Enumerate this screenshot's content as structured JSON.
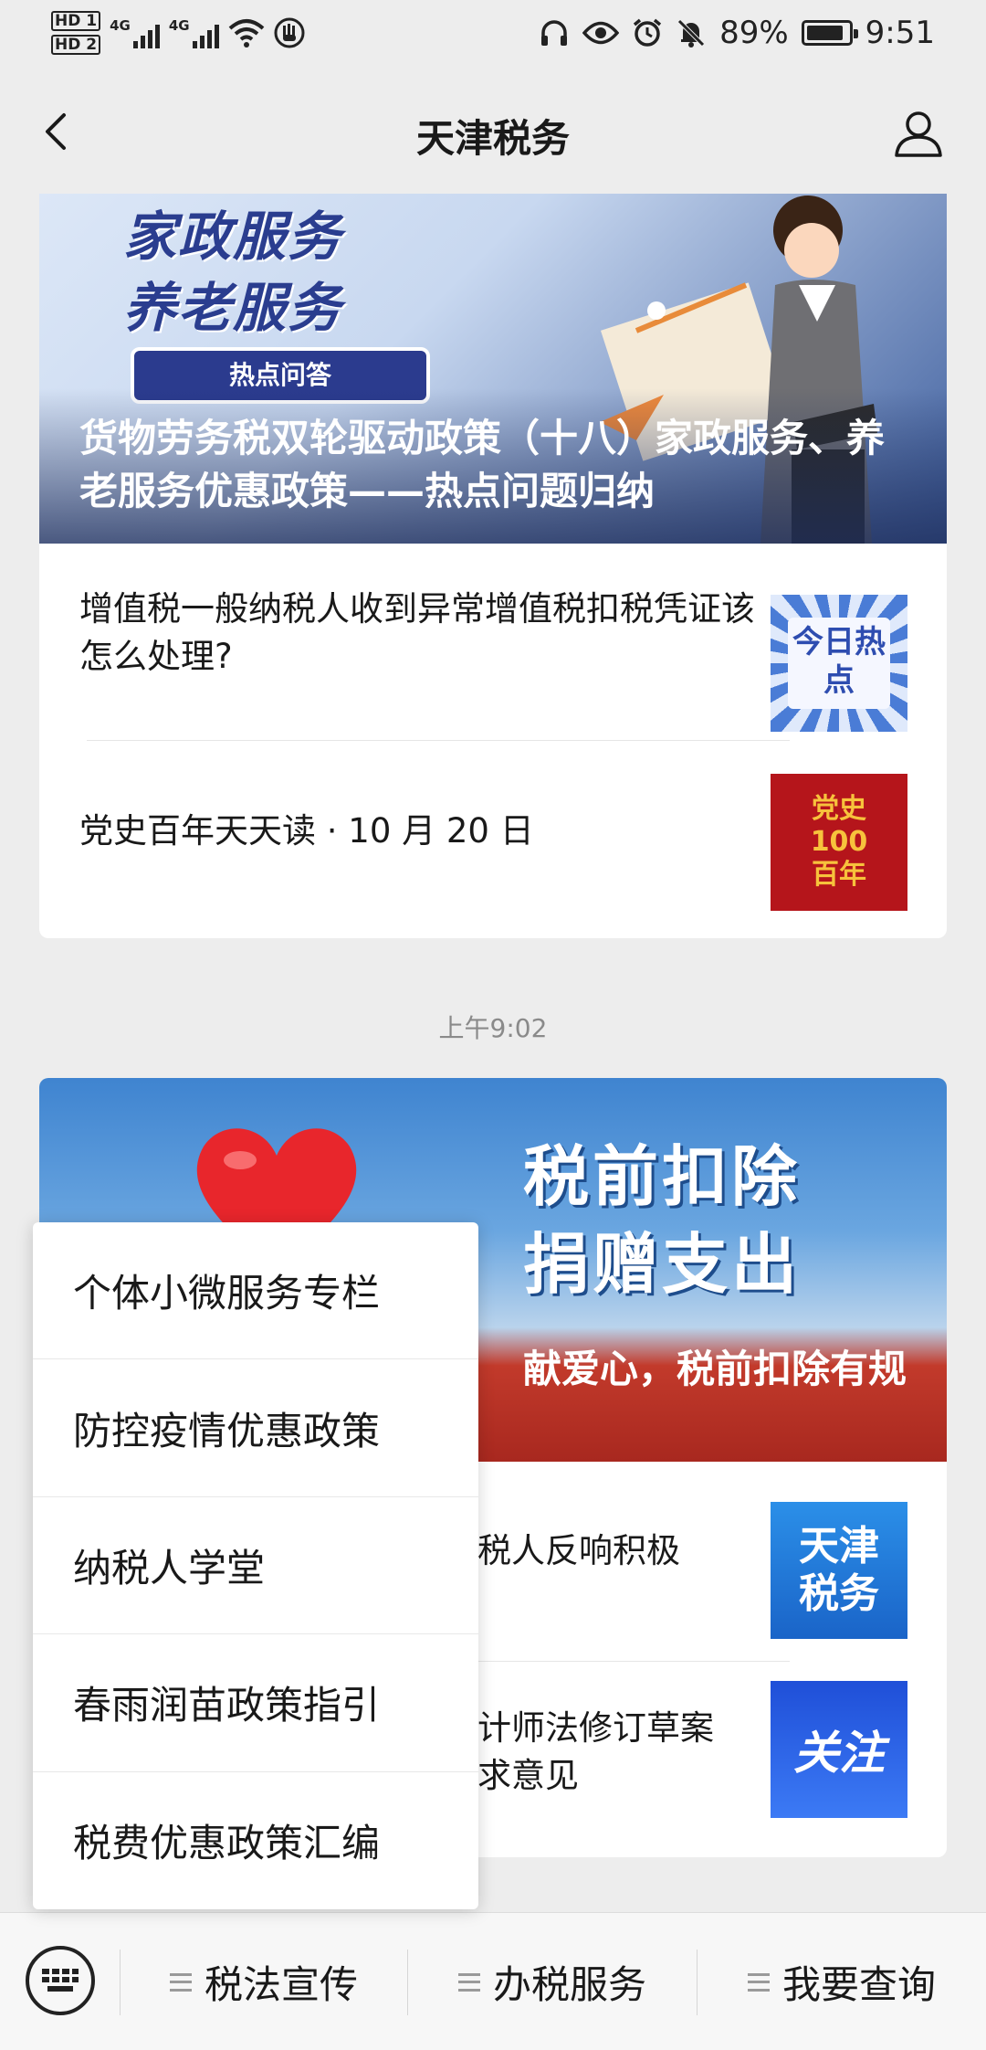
{
  "status_bar": {
    "hd1": "HD 1",
    "hd2": "HD 2",
    "net1": "4G",
    "net2": "4G",
    "battery": "89%",
    "time": "9:51"
  },
  "nav": {
    "title": "天津税务",
    "back_icon": "chevron-left-icon",
    "profile_icon": "user-icon"
  },
  "article_group_1": {
    "banner_big_line1": "家政服务",
    "banner_big_line2": "养老服务",
    "banner_tag": "热点问答",
    "banner_caption": "货物劳务税双轮驱动政策（十八）家政服务、养老服务优惠政策——热点问题归纳",
    "items": [
      {
        "title": "增值税一般纳税人收到异常增值税扣税凭证该怎么处理?",
        "thumb_text": "今日热点"
      },
      {
        "title": "党史百年天天读 · 10 月 20 日",
        "thumb_line1": "党史",
        "thumb_line2": "100",
        "thumb_line3": "百年"
      }
    ]
  },
  "timestamp": "上午9:02",
  "article_group_2": {
    "banner_big_line1": "税前扣除",
    "banner_big_line2": "捐赠支出",
    "banner_caption": "献爱心，税前扣除有规",
    "items": [
      {
        "title": "税人反响积极",
        "thumb_text": "天津税务"
      },
      {
        "title_line1": "计师法修订草案",
        "title_line2": "求意见",
        "thumb_text": "关注"
      }
    ]
  },
  "popup_menu": {
    "items": [
      "个体小微服务专栏",
      "防控疫情优惠政策",
      "纳税人学堂",
      "春雨润苗政策指引",
      "税费优惠政策汇编"
    ]
  },
  "bottom_menu": {
    "keyboard_icon": "keyboard-icon",
    "tabs": [
      "税法宣传",
      "办税服务",
      "我要查询"
    ]
  }
}
